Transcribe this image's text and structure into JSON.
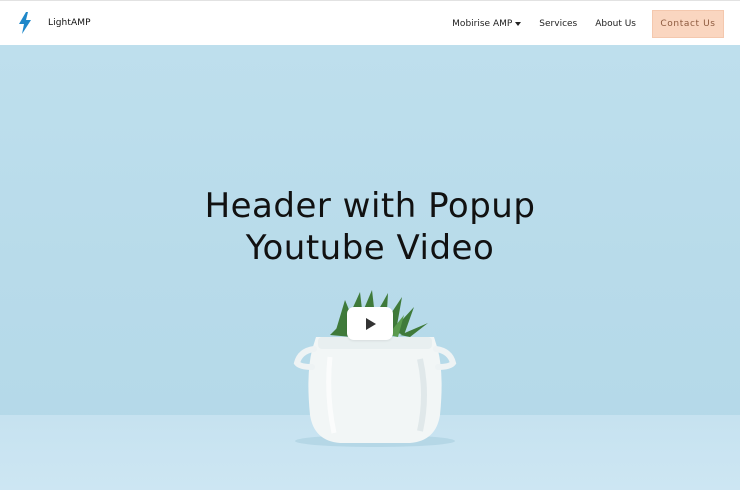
{
  "brand": {
    "name": "LightAMP",
    "icon": "lightning-bolt-icon",
    "icon_color": "#1e87c9"
  },
  "nav": {
    "items": [
      {
        "label": "Mobirise AMP",
        "dropdown": true
      },
      {
        "label": "Services",
        "dropdown": false
      },
      {
        "label": "About Us",
        "dropdown": false
      }
    ],
    "contact_label": "Contact Us",
    "contact_color": "#fad6c0"
  },
  "hero": {
    "title_line1": "Header with Popup",
    "title_line2": "Youtube Video",
    "background_color": "#b8dbea",
    "play_icon": "play-icon"
  }
}
